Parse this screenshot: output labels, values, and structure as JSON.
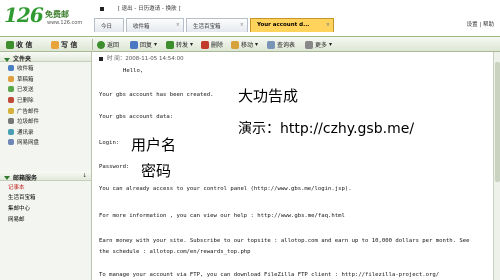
{
  "logo": {
    "number": "126",
    "free": "免费邮",
    "url": "www.126.com"
  },
  "userbar": {
    "text": "[ 退出 - 日历邀请 - 换肤 ]"
  },
  "tabs": [
    {
      "label": "今日"
    },
    {
      "label": "收件箱"
    },
    {
      "label": "生活百宝箱"
    },
    {
      "label": "Your account d..."
    }
  ],
  "topright": {
    "text": "设置 | 帮助"
  },
  "toolbar": {
    "receive": "收 信",
    "compose": "写 信",
    "back": "返回",
    "reply": "回复",
    "forward": "转发",
    "delete": "删除",
    "move": "移动",
    "flag": "查询表",
    "more": "更多"
  },
  "sidebar": {
    "folders_title": "文件夹",
    "folders": [
      "收件箱",
      "草稿箱",
      "已发送",
      "已删除",
      "广告邮件",
      "垃圾邮件",
      "通讯录",
      "网易网盘"
    ],
    "services_title": "邮箱服务",
    "services_more": "↓",
    "services": [
      "记事本",
      "生活百宝箱",
      "集邮中心",
      "网易邮"
    ]
  },
  "mail": {
    "date": "时 间：2008-11-05 14:54:00",
    "lines": [
      "Hello,",
      "Your gbs account has been created.",
      "Your gbs account data:",
      "Login:",
      "Password:",
      "You can already access to your control panel (http://www.gbs.me/login.jsp).",
      "For more information , you can view our help : http://www.gbs.me/faq.html",
      "Earn money with your site. Subscribe to our topsite : allotop.com and earn up to 10,000 dollars per month. See",
      "the schedule : allotop.com/en/rewards_top.php",
      "To manage your account via FTP, you can download FileZilla FTP client : http://filezilla-project.org/"
    ],
    "annotations": {
      "success": "大功告成",
      "demo": "演示：http://czhy.gsb.me/",
      "username": "用户名",
      "password": "密码"
    }
  },
  "colors": {
    "accent_green": "#2f9a2f",
    "active_tab": "#ffd35c"
  }
}
